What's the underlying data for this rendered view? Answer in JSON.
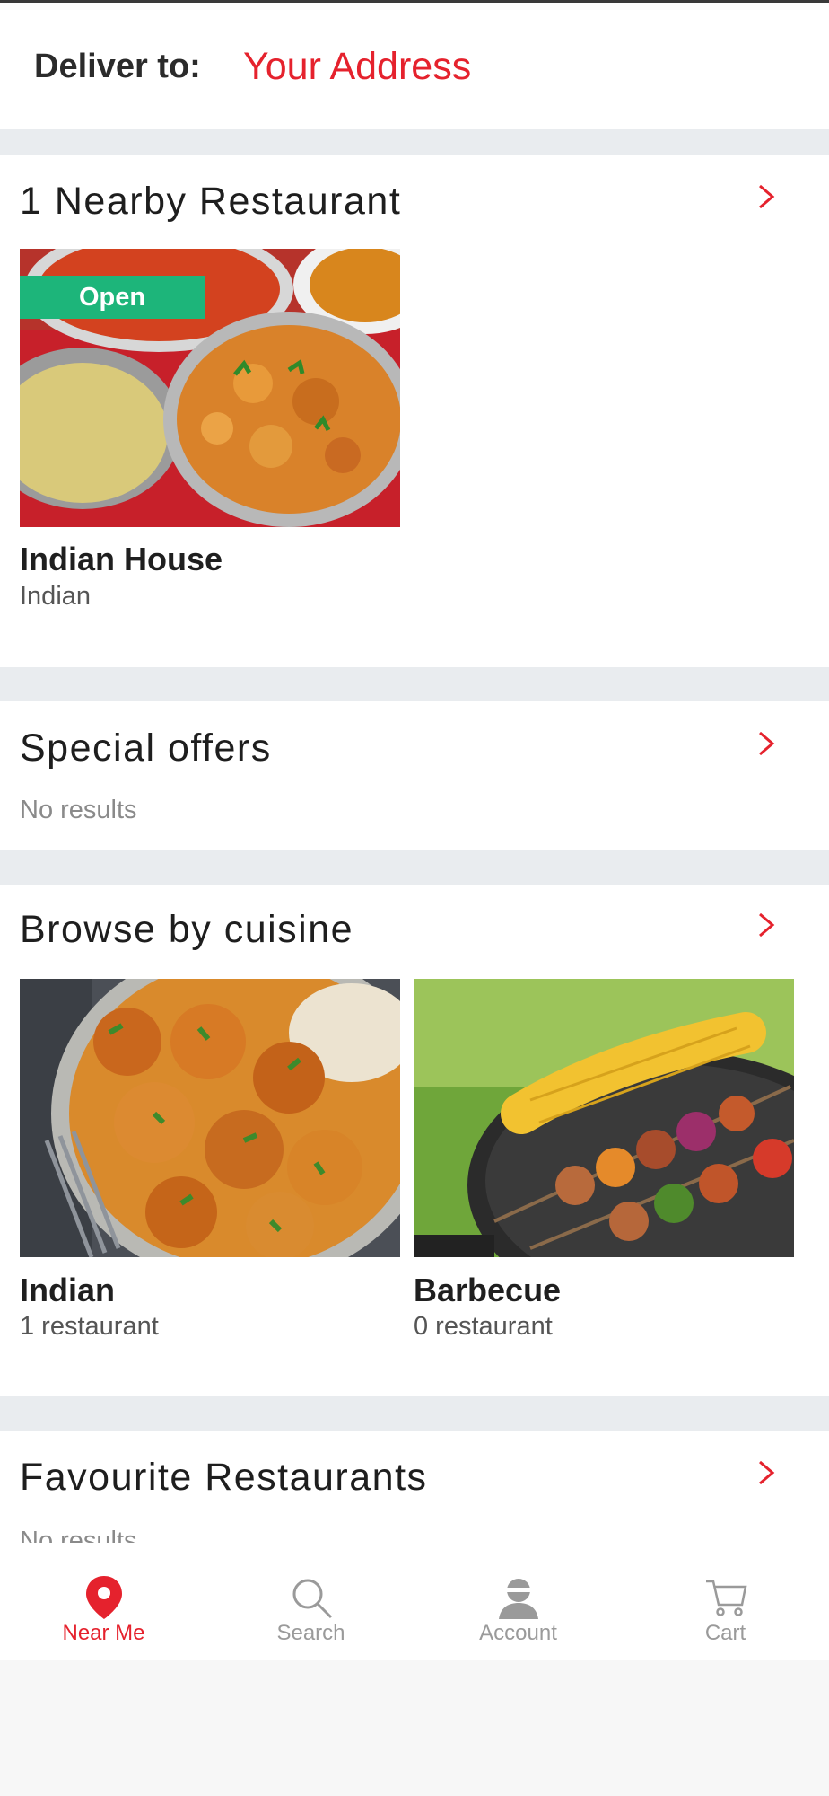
{
  "header": {
    "deliver_label": "Deliver to:",
    "address": "Your Address"
  },
  "nearby": {
    "title": "1 Nearby Restaurant",
    "restaurants": [
      {
        "badge": "Open",
        "name": "Indian House",
        "cuisine": "Indian"
      }
    ]
  },
  "special_offers": {
    "title": "Special offers",
    "empty_text": "No results"
  },
  "cuisines": {
    "title": "Browse by cuisine",
    "items": [
      {
        "name": "Indian",
        "count": "1 restaurant"
      },
      {
        "name": "Barbecue",
        "count": "0 restaurant"
      }
    ]
  },
  "favourites": {
    "title": "Favourite Restaurants",
    "empty_text": "No results"
  },
  "nav": {
    "items": [
      {
        "label": "Near Me",
        "icon": "location-pin-icon",
        "active": true
      },
      {
        "label": "Search",
        "icon": "search-icon",
        "active": false
      },
      {
        "label": "Account",
        "icon": "account-icon",
        "active": false
      },
      {
        "label": "Cart",
        "icon": "cart-icon",
        "active": false
      }
    ]
  },
  "colors": {
    "accent": "#e5222d",
    "open_badge": "#1db57a",
    "section_gap": "#e9ecef"
  }
}
